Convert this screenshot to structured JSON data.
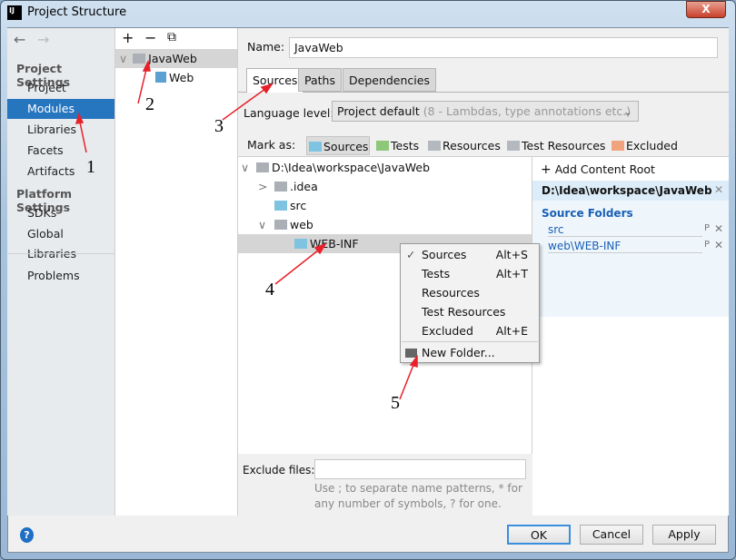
{
  "window": {
    "title": "Project Structure",
    "app_icon": "IJ",
    "close": "X"
  },
  "nav": {
    "back": "←",
    "forward": "→",
    "project_settings": "Project Settings",
    "items": [
      "Project",
      "Modules",
      "Libraries",
      "Facets",
      "Artifacts"
    ],
    "platform_settings": "Platform Settings",
    "platform_items": [
      "SDKs",
      "Global Libraries"
    ],
    "problems": "Problems",
    "selected": "Modules"
  },
  "modules": {
    "toolbar": {
      "add": "+",
      "remove": "−",
      "copy": "⧉"
    },
    "tree": [
      {
        "label": "JavaWeb",
        "expanded": true
      },
      {
        "label": "Web"
      }
    ]
  },
  "detail": {
    "name_label": "Name:",
    "name_value": "JavaWeb",
    "tabs": [
      "Sources",
      "Paths",
      "Dependencies"
    ],
    "active_tab": "Sources",
    "language_label": "Language level:",
    "language_value": "Project default",
    "language_hint": "(8 - Lambdas, type annotations etc.)",
    "mark_as": "Mark as:",
    "mark_buttons": [
      {
        "label": "Sources",
        "color": "#7ec3e0"
      },
      {
        "label": "Tests",
        "color": "#8cc77a"
      },
      {
        "label": "Resources",
        "color": "#b4b9bf"
      },
      {
        "label": "Test Resources",
        "color": "#b4b9bf"
      },
      {
        "label": "Excluded",
        "color": "#f0a37c"
      }
    ],
    "tree": [
      {
        "label": "D:\\Idea\\workspace\\JavaWeb",
        "arrow": "∨"
      },
      {
        "label": ".idea",
        "arrow": ">"
      },
      {
        "label": "src"
      },
      {
        "label": "web",
        "arrow": "∨"
      },
      {
        "label": "WEB-INF",
        "selected": true
      }
    ],
    "exclude_label": "Exclude files:",
    "exclude_value": "",
    "exclude_hint_1": "Use ; to separate name patterns, * for",
    "exclude_hint_2": "any number of symbols, ? for one."
  },
  "content_root": {
    "add": "Add Content Root",
    "root": "D:\\Idea\\workspace\\JavaWeb",
    "source_folders": "Source Folders",
    "folders": [
      "src",
      "web\\WEB-INF"
    ],
    "folder_action": "P"
  },
  "context_menu": {
    "items": [
      {
        "label": "Sources",
        "shortcut": "Alt+S",
        "checked": true
      },
      {
        "label": "Tests",
        "shortcut": "Alt+T"
      },
      {
        "label": "Resources",
        "shortcut": ""
      },
      {
        "label": "Test Resources",
        "shortcut": ""
      },
      {
        "label": "Excluded",
        "shortcut": "Alt+E"
      }
    ],
    "new_folder": "New Folder..."
  },
  "footer": {
    "help": "?",
    "ok": "OK",
    "cancel": "Cancel",
    "apply": "Apply"
  },
  "annotations": [
    "1",
    "2",
    "3",
    "4",
    "5"
  ],
  "colors": {
    "selection": "#2675bf",
    "annotation": "#e8202a",
    "source_folder": "#7ec3e0"
  }
}
